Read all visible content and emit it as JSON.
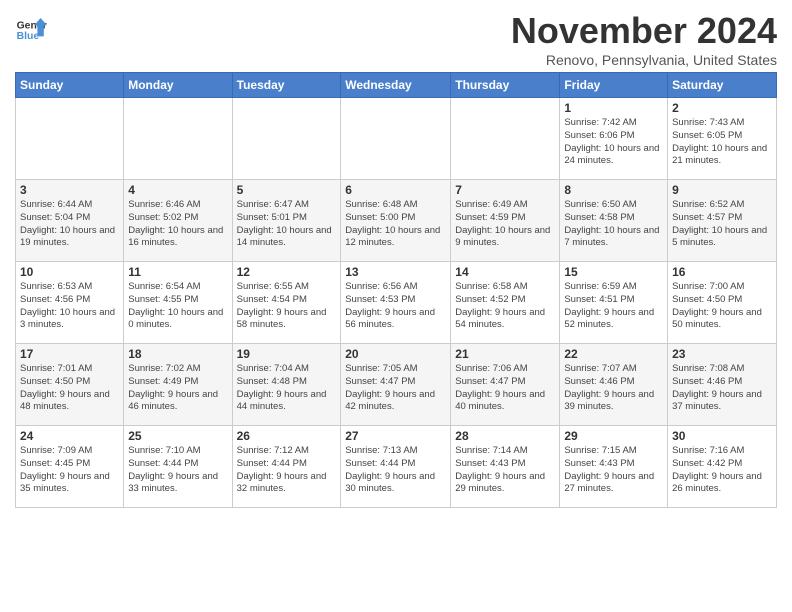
{
  "logo": {
    "line1": "General",
    "line2": "Blue"
  },
  "title": "November 2024",
  "location": "Renovo, Pennsylvania, United States",
  "days_of_week": [
    "Sunday",
    "Monday",
    "Tuesday",
    "Wednesday",
    "Thursday",
    "Friday",
    "Saturday"
  ],
  "weeks": [
    [
      {
        "day": "",
        "info": ""
      },
      {
        "day": "",
        "info": ""
      },
      {
        "day": "",
        "info": ""
      },
      {
        "day": "",
        "info": ""
      },
      {
        "day": "",
        "info": ""
      },
      {
        "day": "1",
        "info": "Sunrise: 7:42 AM\nSunset: 6:06 PM\nDaylight: 10 hours and 24 minutes."
      },
      {
        "day": "2",
        "info": "Sunrise: 7:43 AM\nSunset: 6:05 PM\nDaylight: 10 hours and 21 minutes."
      }
    ],
    [
      {
        "day": "3",
        "info": "Sunrise: 6:44 AM\nSunset: 5:04 PM\nDaylight: 10 hours and 19 minutes."
      },
      {
        "day": "4",
        "info": "Sunrise: 6:46 AM\nSunset: 5:02 PM\nDaylight: 10 hours and 16 minutes."
      },
      {
        "day": "5",
        "info": "Sunrise: 6:47 AM\nSunset: 5:01 PM\nDaylight: 10 hours and 14 minutes."
      },
      {
        "day": "6",
        "info": "Sunrise: 6:48 AM\nSunset: 5:00 PM\nDaylight: 10 hours and 12 minutes."
      },
      {
        "day": "7",
        "info": "Sunrise: 6:49 AM\nSunset: 4:59 PM\nDaylight: 10 hours and 9 minutes."
      },
      {
        "day": "8",
        "info": "Sunrise: 6:50 AM\nSunset: 4:58 PM\nDaylight: 10 hours and 7 minutes."
      },
      {
        "day": "9",
        "info": "Sunrise: 6:52 AM\nSunset: 4:57 PM\nDaylight: 10 hours and 5 minutes."
      }
    ],
    [
      {
        "day": "10",
        "info": "Sunrise: 6:53 AM\nSunset: 4:56 PM\nDaylight: 10 hours and 3 minutes."
      },
      {
        "day": "11",
        "info": "Sunrise: 6:54 AM\nSunset: 4:55 PM\nDaylight: 10 hours and 0 minutes."
      },
      {
        "day": "12",
        "info": "Sunrise: 6:55 AM\nSunset: 4:54 PM\nDaylight: 9 hours and 58 minutes."
      },
      {
        "day": "13",
        "info": "Sunrise: 6:56 AM\nSunset: 4:53 PM\nDaylight: 9 hours and 56 minutes."
      },
      {
        "day": "14",
        "info": "Sunrise: 6:58 AM\nSunset: 4:52 PM\nDaylight: 9 hours and 54 minutes."
      },
      {
        "day": "15",
        "info": "Sunrise: 6:59 AM\nSunset: 4:51 PM\nDaylight: 9 hours and 52 minutes."
      },
      {
        "day": "16",
        "info": "Sunrise: 7:00 AM\nSunset: 4:50 PM\nDaylight: 9 hours and 50 minutes."
      }
    ],
    [
      {
        "day": "17",
        "info": "Sunrise: 7:01 AM\nSunset: 4:50 PM\nDaylight: 9 hours and 48 minutes."
      },
      {
        "day": "18",
        "info": "Sunrise: 7:02 AM\nSunset: 4:49 PM\nDaylight: 9 hours and 46 minutes."
      },
      {
        "day": "19",
        "info": "Sunrise: 7:04 AM\nSunset: 4:48 PM\nDaylight: 9 hours and 44 minutes."
      },
      {
        "day": "20",
        "info": "Sunrise: 7:05 AM\nSunset: 4:47 PM\nDaylight: 9 hours and 42 minutes."
      },
      {
        "day": "21",
        "info": "Sunrise: 7:06 AM\nSunset: 4:47 PM\nDaylight: 9 hours and 40 minutes."
      },
      {
        "day": "22",
        "info": "Sunrise: 7:07 AM\nSunset: 4:46 PM\nDaylight: 9 hours and 39 minutes."
      },
      {
        "day": "23",
        "info": "Sunrise: 7:08 AM\nSunset: 4:46 PM\nDaylight: 9 hours and 37 minutes."
      }
    ],
    [
      {
        "day": "24",
        "info": "Sunrise: 7:09 AM\nSunset: 4:45 PM\nDaylight: 9 hours and 35 minutes."
      },
      {
        "day": "25",
        "info": "Sunrise: 7:10 AM\nSunset: 4:44 PM\nDaylight: 9 hours and 33 minutes."
      },
      {
        "day": "26",
        "info": "Sunrise: 7:12 AM\nSunset: 4:44 PM\nDaylight: 9 hours and 32 minutes."
      },
      {
        "day": "27",
        "info": "Sunrise: 7:13 AM\nSunset: 4:44 PM\nDaylight: 9 hours and 30 minutes."
      },
      {
        "day": "28",
        "info": "Sunrise: 7:14 AM\nSunset: 4:43 PM\nDaylight: 9 hours and 29 minutes."
      },
      {
        "day": "29",
        "info": "Sunrise: 7:15 AM\nSunset: 4:43 PM\nDaylight: 9 hours and 27 minutes."
      },
      {
        "day": "30",
        "info": "Sunrise: 7:16 AM\nSunset: 4:42 PM\nDaylight: 9 hours and 26 minutes."
      }
    ]
  ]
}
